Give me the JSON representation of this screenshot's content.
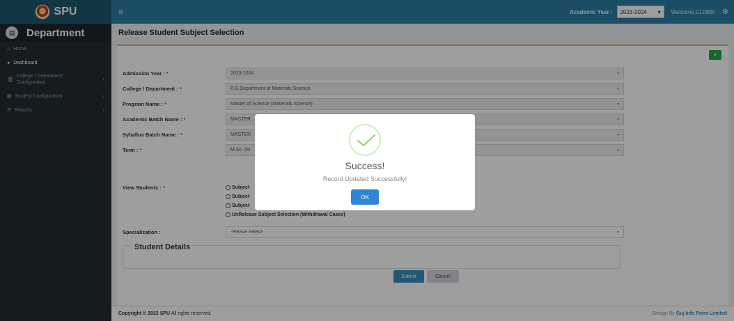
{
  "topbar": {
    "brand": "SPU",
    "academic_year_label": "Academic Year :",
    "academic_year_value": "2023-2024",
    "welcome": "Welcome,CL0890"
  },
  "sidebar": {
    "title": "Department",
    "items": [
      {
        "label": "Home",
        "icon": "home-icon"
      },
      {
        "label": "Dashboard",
        "icon": "dashboard-icon"
      },
      {
        "label": "College / Department Configuration",
        "icon": "bank-icon"
      },
      {
        "label": "Student Configuration",
        "icon": "grid-icon"
      },
      {
        "label": "Reports",
        "icon": "list-icon"
      }
    ]
  },
  "page": {
    "title": "Release Student Subject Selection"
  },
  "form": {
    "admission_year": {
      "label": "Admission Year :",
      "value": "2023-2024"
    },
    "college": {
      "label": "College / Department :",
      "value": "P.G.Department of Materials Science"
    },
    "program": {
      "label": "Program Name :",
      "value": "Master of Science (Materials Science)"
    },
    "academic_batch": {
      "label": "Academic Batch Name :",
      "value": "MASTER"
    },
    "syllabus_batch": {
      "label": "Syballus Batch Name :",
      "value": "MASTER"
    },
    "term": {
      "label": "Term :",
      "value": "M.Sc. (M"
    },
    "view_students": {
      "label": "View Students :",
      "options": [
        "Subject",
        "Subject",
        "Subject",
        "UnRelease Subject Selection (Withdrawal Cases)"
      ]
    },
    "specialization": {
      "label": "Specialization :",
      "value": "-Please Select-"
    },
    "required_mark": "*"
  },
  "student_details": {
    "legend": "Student Details"
  },
  "buttons": {
    "submit": "Submit",
    "cancel": "Cancel"
  },
  "footer": {
    "copyright_prefix": "Copyright © 2023",
    "copyright_org": "SPU",
    "copyright_suffix": "All rights reserved.",
    "design_prefix": "Design By",
    "design_org": "Guj Info Petro Limited"
  },
  "modal": {
    "title": "Success!",
    "message": "Record Updated Successfully!",
    "ok": "OK"
  },
  "colors": {
    "navbar": "#2c7ea2",
    "logo_bg": "#1d5a6f",
    "sidebar": "#222d32",
    "box_top": "#f0ad4e",
    "success": "#a5dc86",
    "ok_button": "#3085d6"
  }
}
